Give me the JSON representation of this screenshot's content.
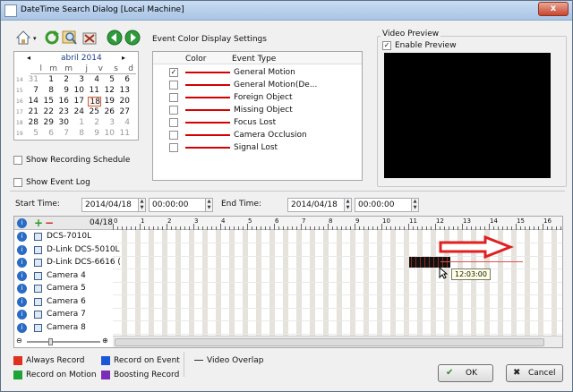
{
  "window": {
    "title": "DateTime Search Dialog [Local Machine]",
    "close_label": "x"
  },
  "calendar": {
    "month_label": "abril 2014",
    "weekday_headers": [
      "l",
      "m",
      "m",
      "j",
      "v",
      "s",
      "d"
    ],
    "weeks": [
      {
        "wk": "14",
        "days": [
          "31",
          "1",
          "2",
          "3",
          "4",
          "5",
          "6"
        ]
      },
      {
        "wk": "15",
        "days": [
          "7",
          "8",
          "9",
          "10",
          "11",
          "12",
          "13"
        ]
      },
      {
        "wk": "16",
        "days": [
          "14",
          "15",
          "16",
          "17",
          "18",
          "19",
          "20"
        ]
      },
      {
        "wk": "17",
        "days": [
          "21",
          "22",
          "23",
          "24",
          "25",
          "26",
          "27"
        ]
      },
      {
        "wk": "18",
        "days": [
          "28",
          "29",
          "30",
          "1",
          "2",
          "3",
          "4"
        ]
      },
      {
        "wk": "19",
        "days": [
          "5",
          "6",
          "7",
          "8",
          "9",
          "10",
          "11"
        ]
      }
    ],
    "selected_day": "18",
    "prev_label": "◂",
    "next_label": "▸"
  },
  "options": {
    "show_recording_schedule": "Show Recording Schedule",
    "show_event_log": "Show Event Log"
  },
  "event_color": {
    "title": "Event Color Display Settings",
    "col_color": "Color",
    "col_type": "Event Type",
    "rows": [
      {
        "label": "General Motion",
        "checked": true
      },
      {
        "label": "General Motion(De...",
        "checked": false
      },
      {
        "label": "Foreign Object",
        "checked": false
      },
      {
        "label": "Missing Object",
        "checked": false
      },
      {
        "label": "Focus Lost",
        "checked": false
      },
      {
        "label": "Camera Occlusion",
        "checked": false
      },
      {
        "label": "Signal Lost",
        "checked": false
      }
    ],
    "line_color": "#d60000"
  },
  "video_preview": {
    "title": "Video Preview",
    "enable_label": "Enable Preview"
  },
  "time": {
    "start_label": "Start Time:",
    "start_date": "2014/04/18",
    "start_time": "00:00:00",
    "end_label": "End Time:",
    "end_date": "2014/04/18",
    "end_time": "00:00:00"
  },
  "timeline": {
    "date_label": "04/18",
    "hours": [
      "0",
      "1",
      "2",
      "3",
      "4",
      "5",
      "6",
      "7",
      "8",
      "9",
      "10",
      "11",
      "12",
      "13",
      "14",
      "15",
      "16"
    ],
    "cameras": [
      "DCS-7010L",
      "D-Link DCS-5010L",
      "D-Link DCS-6616 (",
      "Camera 4",
      "Camera 5",
      "Camera 6",
      "Camera 7",
      "Camera 8"
    ],
    "tooltip": "12:03:00"
  },
  "legend": {
    "always": "Always Record",
    "event": "Record on Event",
    "motion": "Record on Motion",
    "boost": "Boosting Record",
    "overlap": "Video Overlap",
    "colors": {
      "always": "#e0301e",
      "event": "#1a57d6",
      "motion": "#1ea337",
      "boost": "#7b2cb8"
    }
  },
  "buttons": {
    "ok": "OK",
    "cancel": "Cancel",
    "ok_mark": "✔",
    "cancel_mark": "✖"
  }
}
